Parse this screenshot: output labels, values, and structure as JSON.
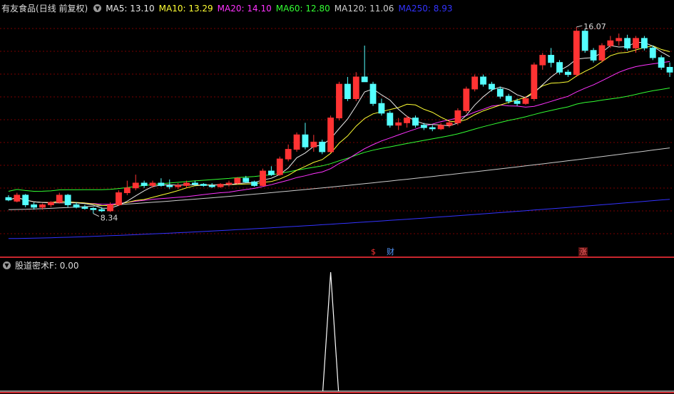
{
  "stock": {
    "name": "有友食品",
    "period": "(日线 前复权)"
  },
  "legend": [
    {
      "key": "ma5",
      "label": "MA5:",
      "value": "13.10",
      "color": "#e8e8e8"
    },
    {
      "key": "ma10",
      "label": "MA10:",
      "value": "13.29",
      "color": "#ffff33"
    },
    {
      "key": "ma20",
      "label": "MA20:",
      "value": "14.10",
      "color": "#ff33ff"
    },
    {
      "key": "ma60",
      "label": "MA60:",
      "value": "12.80",
      "color": "#33ff33"
    },
    {
      "key": "ma120",
      "label": "MA120:",
      "value": "11.06",
      "color": "#cccccc"
    },
    {
      "key": "ma250",
      "label": "MA250:",
      "value": "8.93",
      "color": "#3333ff"
    }
  ],
  "annotations": {
    "high_label": "16.07",
    "low_label": "8.34"
  },
  "markers": [
    {
      "text": "$",
      "color": "#ff3333"
    },
    {
      "text": "财",
      "color": "#5599ff"
    },
    {
      "text": "涨",
      "color": "#ff6666"
    }
  ],
  "indicator": {
    "name": "股道密术F",
    "value_text": ": 0.00"
  },
  "colors": {
    "up": "#ff3333",
    "down": "#54ffff",
    "grid": "#7a0000",
    "divider": "#c8262d"
  },
  "chart_data": {
    "type": "candlestick",
    "x_axis": "trading days (unlabeled)",
    "y_range": [
      7.0,
      16.6
    ],
    "high": 16.07,
    "low": 8.34,
    "candles": [
      [
        9.0,
        9.1,
        8.85,
        8.9
      ],
      [
        8.85,
        9.2,
        8.8,
        9.1
      ],
      [
        9.1,
        9.15,
        8.6,
        8.7
      ],
      [
        8.7,
        8.8,
        8.5,
        8.6
      ],
      [
        8.6,
        8.75,
        8.5,
        8.7
      ],
      [
        8.7,
        8.85,
        8.6,
        8.8
      ],
      [
        8.8,
        9.2,
        8.75,
        9.1
      ],
      [
        9.1,
        9.15,
        8.6,
        8.7
      ],
      [
        8.7,
        8.8,
        8.55,
        8.6
      ],
      [
        8.6,
        8.7,
        8.5,
        8.55
      ],
      [
        8.55,
        8.6,
        8.34,
        8.5
      ],
      [
        8.5,
        8.6,
        8.4,
        8.45
      ],
      [
        8.45,
        8.8,
        8.4,
        8.7
      ],
      [
        8.7,
        9.3,
        8.65,
        9.2
      ],
      [
        9.2,
        9.7,
        9.1,
        9.4
      ],
      [
        9.4,
        9.95,
        9.3,
        9.6
      ],
      [
        9.6,
        9.7,
        9.4,
        9.5
      ],
      [
        9.5,
        9.7,
        9.4,
        9.6
      ],
      [
        9.6,
        9.8,
        9.45,
        9.5
      ],
      [
        9.5,
        9.75,
        9.35,
        9.45
      ],
      [
        9.45,
        9.6,
        9.35,
        9.5
      ],
      [
        9.5,
        9.7,
        9.4,
        9.6
      ],
      [
        9.6,
        9.7,
        9.5,
        9.55
      ],
      [
        9.55,
        9.6,
        9.45,
        9.5
      ],
      [
        9.5,
        9.6,
        9.4,
        9.45
      ],
      [
        9.45,
        9.6,
        9.4,
        9.55
      ],
      [
        9.55,
        9.7,
        9.45,
        9.6
      ],
      [
        9.6,
        9.85,
        9.55,
        9.8
      ],
      [
        9.8,
        9.9,
        9.6,
        9.65
      ],
      [
        9.65,
        9.7,
        9.45,
        9.5
      ],
      [
        9.5,
        10.2,
        9.45,
        10.1
      ],
      [
        10.1,
        10.3,
        9.9,
        9.95
      ],
      [
        9.95,
        10.7,
        9.9,
        10.6
      ],
      [
        10.6,
        11.2,
        10.5,
        11.0
      ],
      [
        11.0,
        11.7,
        10.9,
        11.6
      ],
      [
        11.6,
        12.1,
        11.0,
        11.1
      ],
      [
        11.1,
        11.6,
        10.9,
        11.3
      ],
      [
        11.3,
        11.4,
        10.8,
        10.9
      ],
      [
        10.9,
        12.4,
        10.85,
        12.3
      ],
      [
        12.3,
        13.8,
        12.2,
        13.7
      ],
      [
        13.7,
        14.0,
        13.0,
        13.1
      ],
      [
        13.1,
        14.2,
        13.0,
        14.0
      ],
      [
        14.0,
        15.3,
        13.9,
        13.8
      ],
      [
        13.7,
        13.8,
        12.8,
        12.9
      ],
      [
        12.9,
        13.1,
        12.4,
        12.5
      ],
      [
        12.5,
        12.6,
        11.9,
        12.0
      ],
      [
        12.0,
        12.3,
        11.8,
        12.1
      ],
      [
        12.1,
        12.4,
        11.9,
        12.3
      ],
      [
        12.3,
        12.4,
        11.9,
        12.0
      ],
      [
        12.0,
        12.1,
        11.8,
        11.9
      ],
      [
        11.9,
        12.0,
        11.75,
        11.85
      ],
      [
        11.85,
        12.1,
        11.8,
        12.0
      ],
      [
        12.0,
        12.2,
        11.9,
        12.1
      ],
      [
        12.1,
        12.7,
        12.0,
        12.6
      ],
      [
        12.6,
        13.6,
        12.5,
        13.5
      ],
      [
        13.5,
        14.1,
        13.4,
        14.0
      ],
      [
        14.0,
        14.1,
        13.6,
        13.7
      ],
      [
        13.7,
        13.8,
        13.4,
        13.5
      ],
      [
        13.5,
        13.6,
        13.1,
        13.2
      ],
      [
        13.2,
        13.3,
        12.9,
        13.0
      ],
      [
        13.0,
        13.1,
        12.8,
        12.9
      ],
      [
        12.9,
        13.2,
        12.85,
        13.1
      ],
      [
        13.1,
        14.6,
        13.0,
        14.5
      ],
      [
        14.5,
        15.0,
        14.3,
        14.9
      ],
      [
        14.9,
        15.2,
        14.4,
        14.6
      ],
      [
        14.6,
        14.7,
        14.1,
        14.2
      ],
      [
        14.2,
        14.3,
        14.0,
        14.1
      ],
      [
        14.1,
        16.07,
        14.0,
        15.9
      ],
      [
        15.9,
        16.0,
        15.0,
        15.1
      ],
      [
        15.1,
        15.2,
        14.6,
        14.7
      ],
      [
        14.7,
        15.4,
        14.6,
        15.3
      ],
      [
        15.3,
        15.7,
        15.2,
        15.5
      ],
      [
        15.5,
        15.8,
        15.3,
        15.6
      ],
      [
        15.6,
        15.75,
        15.1,
        15.2
      ],
      [
        15.2,
        15.7,
        15.0,
        15.6
      ],
      [
        15.6,
        15.7,
        15.1,
        15.2
      ],
      [
        15.2,
        15.3,
        14.7,
        14.8
      ],
      [
        14.8,
        14.9,
        14.3,
        14.4
      ],
      [
        14.4,
        14.6,
        14.0,
        14.2
      ]
    ],
    "ma_series": {
      "ma5": {
        "start": 8.95,
        "end": 13.1
      },
      "ma10": {
        "start": 8.9,
        "end": 13.29
      },
      "ma20": {
        "start": 8.95,
        "end": 14.1
      },
      "ma60": {
        "start": 9.8,
        "end": 12.8
      },
      "ma120": {
        "start": 8.5,
        "end": 11.06
      },
      "ma250": {
        "start": 7.3,
        "end": 8.93
      }
    },
    "indicator_series": {
      "name": "股道密术F",
      "baseline": 0,
      "spike_at_candle": 38,
      "spike_value": 1
    }
  }
}
